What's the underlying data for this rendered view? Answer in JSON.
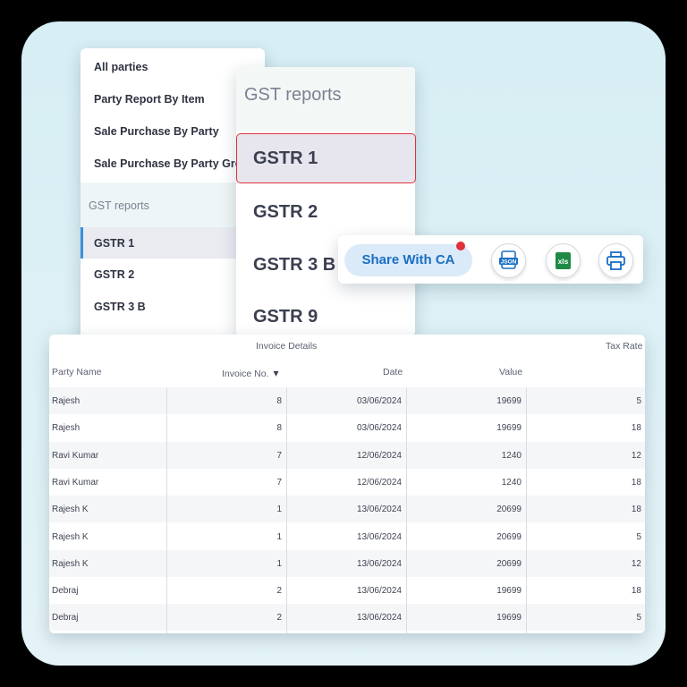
{
  "menu": {
    "items": [
      "All parties",
      "Party Report By Item",
      "Sale Purchase By Party",
      "Sale Purchase By Party Group"
    ],
    "section": "GST reports",
    "sub_items": [
      "GSTR 1",
      "GSTR 2",
      "GSTR 3 B"
    ],
    "active_sub": "GSTR 1"
  },
  "gst_popup": {
    "title": "GST reports",
    "items": [
      "GSTR 1",
      "GSTR 2",
      "GSTR 3 B",
      "GSTR 9"
    ],
    "selected": "GSTR 1"
  },
  "toolbar": {
    "share_label": "Share With CA",
    "json_icon_text": "JSON",
    "xls_icon_text": "xls",
    "notification_color": "#e0303a",
    "accent": "#1a6fc4"
  },
  "table": {
    "group_header": "Invoice Details",
    "tax_rate_header": "Tax Rate",
    "columns": {
      "party_name": "Party Name",
      "invoice_no": "Invoice No.",
      "date": "Date",
      "value": "Value"
    },
    "sort_indicator": "▾",
    "rows": [
      {
        "party": "Rajesh",
        "invoice": "8",
        "date": "03/06/2024",
        "value": "19699",
        "tax": "5"
      },
      {
        "party": "Rajesh",
        "invoice": "8",
        "date": "03/06/2024",
        "value": "19699",
        "tax": "18"
      },
      {
        "party": "Ravi Kumar",
        "invoice": "7",
        "date": "12/06/2024",
        "value": "1240",
        "tax": "12"
      },
      {
        "party": "Ravi Kumar",
        "invoice": "7",
        "date": "12/06/2024",
        "value": "1240",
        "tax": "18"
      },
      {
        "party": "Rajesh K",
        "invoice": "1",
        "date": "13/06/2024",
        "value": "20699",
        "tax": "18"
      },
      {
        "party": "Rajesh K",
        "invoice": "1",
        "date": "13/06/2024",
        "value": "20699",
        "tax": "5"
      },
      {
        "party": "Rajesh K",
        "invoice": "1",
        "date": "13/06/2024",
        "value": "20699",
        "tax": "12"
      },
      {
        "party": "Debraj",
        "invoice": "2",
        "date": "13/06/2024",
        "value": "19699",
        "tax": "18"
      },
      {
        "party": "Debraj",
        "invoice": "2",
        "date": "13/06/2024",
        "value": "19699",
        "tax": "5"
      }
    ]
  }
}
